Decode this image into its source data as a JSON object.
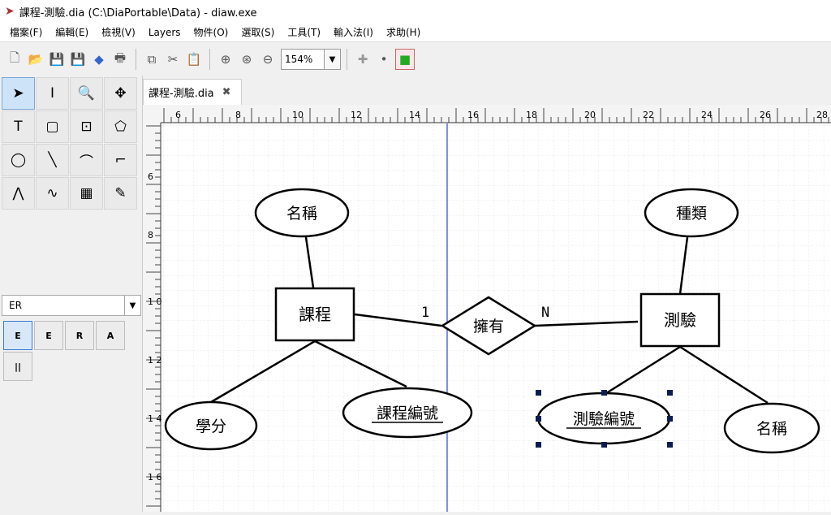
{
  "window": {
    "title": "課程-測驗.dia (C:\\DiaPortable\\Data) - diaw.exe"
  },
  "menu": [
    {
      "label": "檔案(F)"
    },
    {
      "label": "編輯(E)"
    },
    {
      "label": "檢視(V)"
    },
    {
      "label": "Layers"
    },
    {
      "label": "物件(O)"
    },
    {
      "label": "選取(S)"
    },
    {
      "label": "工具(T)"
    },
    {
      "label": "輸入法(I)"
    },
    {
      "label": "求助(H)"
    }
  ],
  "toolbar": {
    "zoom_value": "154%"
  },
  "toolbox": {
    "tools": [
      {
        "icon": "pointer-icon",
        "glyph": "➤"
      },
      {
        "icon": "text-cursor-icon",
        "glyph": "I"
      },
      {
        "icon": "magnify-icon",
        "glyph": "🔍"
      },
      {
        "icon": "move-icon",
        "glyph": "✥"
      },
      {
        "icon": "text-tool-icon",
        "glyph": "T"
      },
      {
        "icon": "box-tool-icon",
        "glyph": "▢"
      },
      {
        "icon": "box-tool-2-icon",
        "glyph": "⊡"
      },
      {
        "icon": "polygon-tool-icon",
        "glyph": "⬠"
      },
      {
        "icon": "ellipse-tool-icon",
        "glyph": "◯"
      },
      {
        "icon": "line-tool-icon",
        "glyph": "╲"
      },
      {
        "icon": "arc-tool-icon",
        "glyph": "⌒"
      },
      {
        "icon": "zigzag-tool-icon",
        "glyph": "⌐"
      },
      {
        "icon": "polyline-tool-icon",
        "glyph": "⋀"
      },
      {
        "icon": "bezier-tool-icon",
        "glyph": "∿"
      },
      {
        "icon": "image-tool-icon",
        "glyph": "▦"
      },
      {
        "icon": "outline-tool-icon",
        "glyph": "✎"
      }
    ],
    "sheet": "ER",
    "shapes": [
      {
        "icon": "entity-shape-icon",
        "glyph": "E"
      },
      {
        "icon": "weak-entity-shape-icon",
        "glyph": "E"
      },
      {
        "icon": "relationship-shape-icon",
        "glyph": "R"
      },
      {
        "icon": "attribute-shape-icon",
        "glyph": "A"
      },
      {
        "icon": "participation-shape-icon",
        "glyph": "||"
      }
    ]
  },
  "tab": {
    "label": "課程-測驗.dia"
  },
  "rulers": {
    "top": [
      "6",
      "8",
      "10",
      "12",
      "14",
      "16",
      "18",
      "20",
      "22",
      "24",
      "26",
      "28"
    ],
    "left": [
      "6",
      "8",
      "1\n0",
      "1\n2",
      "1\n4",
      "1\n6"
    ]
  },
  "diagram": {
    "entities": [
      {
        "name": "course",
        "label": "課程"
      },
      {
        "name": "quiz",
        "label": "測驗"
      }
    ],
    "relationship": {
      "label": "擁有",
      "left_card": "1",
      "right_card": "N"
    },
    "attributes": [
      {
        "name": "course-name",
        "label": "名稱",
        "key": false
      },
      {
        "name": "course-credit",
        "label": "學分",
        "key": false
      },
      {
        "name": "course-id",
        "label": "課程編號",
        "key": true
      },
      {
        "name": "quiz-type",
        "label": "種類",
        "key": false
      },
      {
        "name": "quiz-id",
        "label": "測驗編號",
        "key": true
      },
      {
        "name": "quiz-name",
        "label": "名稱",
        "key": false
      }
    ]
  }
}
